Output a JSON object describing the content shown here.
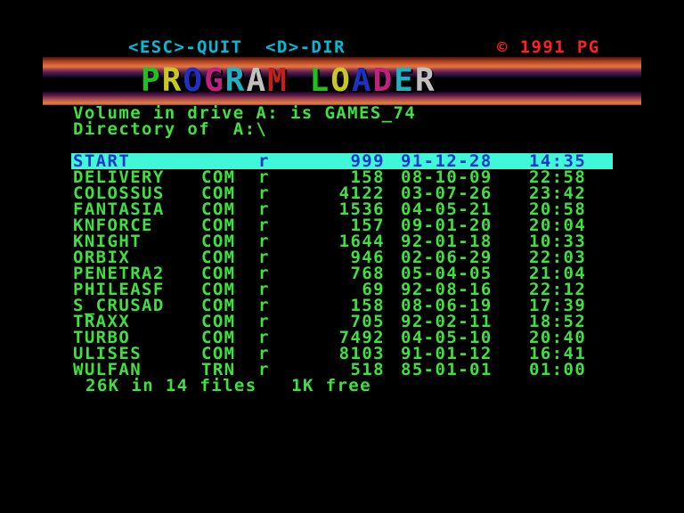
{
  "header": {
    "keys": "<ESC>-QUIT  <D>-DIR",
    "copyright": "© 1991 PG"
  },
  "banner": {
    "letters": [
      {
        "ch": "P",
        "color": "#20c020"
      },
      {
        "ch": "R",
        "color": "#c8c820"
      },
      {
        "ch": "O",
        "color": "#2030c0"
      },
      {
        "ch": "G",
        "color": "#c02080"
      },
      {
        "ch": "R",
        "color": "#20b0c0"
      },
      {
        "ch": "A",
        "color": "#c0c0c0"
      },
      {
        "ch": "M",
        "color": "#c02020"
      },
      {
        "ch": " ",
        "color": "#000000"
      },
      {
        "ch": "L",
        "color": "#20c020"
      },
      {
        "ch": "O",
        "color": "#c8c820"
      },
      {
        "ch": "A",
        "color": "#2030c0"
      },
      {
        "ch": "D",
        "color": "#c02080"
      },
      {
        "ch": "E",
        "color": "#20b0c0"
      },
      {
        "ch": "R",
        "color": "#c0c0c0"
      }
    ]
  },
  "volume_line": "Volume in drive A: is GAMES_74",
  "dir_line": "Directory of  A:\\",
  "files": [
    {
      "name": "START",
      "ext": "",
      "attr": "r",
      "size": "999",
      "date": "91-12-28",
      "time": "14:35",
      "selected": true
    },
    {
      "name": "DELIVERY",
      "ext": "COM",
      "attr": "r",
      "size": "158",
      "date": "08-10-09",
      "time": "22:58"
    },
    {
      "name": "COLOSSUS",
      "ext": "COM",
      "attr": "r",
      "size": "4122",
      "date": "03-07-26",
      "time": "23:42"
    },
    {
      "name": "FANTASIA",
      "ext": "COM",
      "attr": "r",
      "size": "1536",
      "date": "04-05-21",
      "time": "20:58"
    },
    {
      "name": "KNFORCE",
      "ext": "COM",
      "attr": "r",
      "size": "157",
      "date": "09-01-20",
      "time": "20:04"
    },
    {
      "name": "KNIGHT",
      "ext": "COM",
      "attr": "r",
      "size": "1644",
      "date": "92-01-18",
      "time": "10:33"
    },
    {
      "name": "ORBIX",
      "ext": "COM",
      "attr": "r",
      "size": "946",
      "date": "02-06-29",
      "time": "22:03"
    },
    {
      "name": "PENETRA2",
      "ext": "COM",
      "attr": "r",
      "size": "768",
      "date": "05-04-05",
      "time": "21:04"
    },
    {
      "name": "PHILEASF",
      "ext": "COM",
      "attr": "r",
      "size": "69",
      "date": "92-08-16",
      "time": "22:12"
    },
    {
      "name": "S_CRUSAD",
      "ext": "COM",
      "attr": "r",
      "size": "158",
      "date": "08-06-19",
      "time": "17:39"
    },
    {
      "name": "TRAXX",
      "ext": "COM",
      "attr": "r",
      "size": "705",
      "date": "92-02-11",
      "time": "18:52"
    },
    {
      "name": "TURBO",
      "ext": "COM",
      "attr": "r",
      "size": "7492",
      "date": "04-05-10",
      "time": "20:40"
    },
    {
      "name": "ULISES",
      "ext": "COM",
      "attr": "r",
      "size": "8103",
      "date": "91-01-12",
      "time": "16:41"
    },
    {
      "name": "WULFAN",
      "ext": "TRN",
      "attr": "r",
      "size": "518",
      "date": "85-01-01",
      "time": "01:00"
    }
  ],
  "summary_line": "26K in 14 files   1K free",
  "colors": {
    "background": "#000000",
    "text": "#40e040",
    "header_keys": "#00bcd8",
    "copyright": "#ff2020",
    "selection_bg": "#40f8d8",
    "selection_text": "#1838c8"
  }
}
